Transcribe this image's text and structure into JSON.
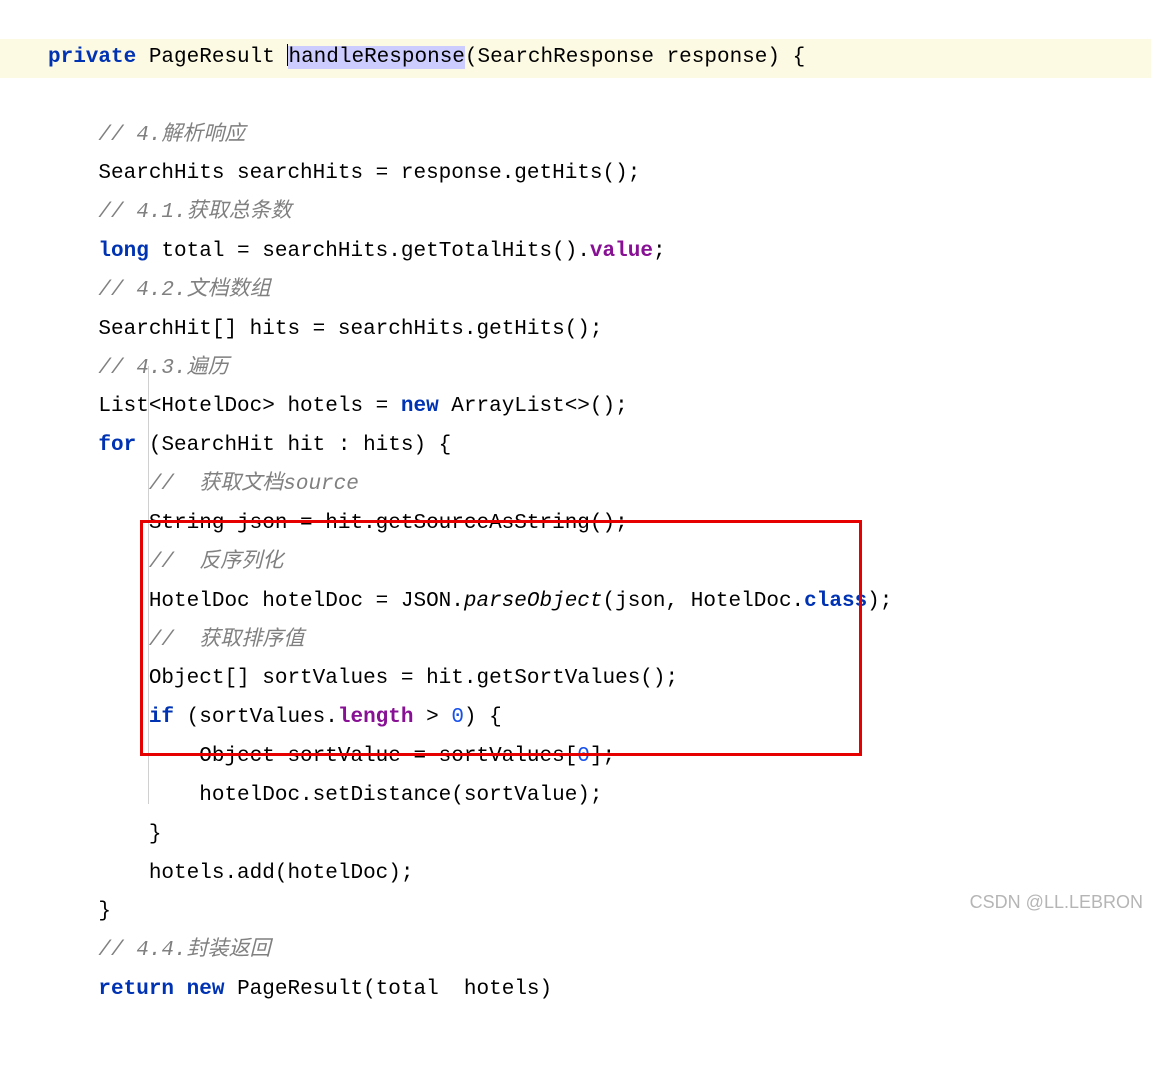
{
  "signature": {
    "modifier": "private",
    "returnType": "PageResult",
    "methodName": "handleResponse",
    "paramType": "SearchResponse",
    "paramName": "response",
    "open": "{"
  },
  "lines": {
    "c4": "// 4.解析响应",
    "l1a": "SearchHits searchHits = response.getHits();",
    "c41": "// 4.1.获取总条数",
    "l2_kw": "long",
    "l2_mid": " total = searchHits.getTotalHits().",
    "l2_field": "value",
    "l2_end": ";",
    "c42": "// 4.2.文档数组",
    "l3": "SearchHit[] hits = searchHits.getHits();",
    "c43": "// 4.3.遍历",
    "l4a": "List<HotelDoc> hotels = ",
    "l4_new": "new",
    "l4b": " ArrayList<>();",
    "l5_for": "for",
    "l5_rest": " (SearchHit hit : hits) {",
    "c_src": "//  获取文档source",
    "l6": "String json = hit.getSourceAsString();",
    "c_des": "//  反序列化",
    "l7a": "HotelDoc hotelDoc = JSON.",
    "l7_m": "parseObject",
    "l7b": "(json, HotelDoc.",
    "l7_cls": "class",
    "l7c": ");",
    "c_sort": "//  获取排序值",
    "l8": "Object[] sortValues = hit.getSortValues();",
    "l9_if": "if",
    "l9a": " (sortValues.",
    "l9_len": "length",
    "l9b": " > ",
    "l9_zero": "0",
    "l9c": ") {",
    "l10a": "Object sortValue = sortValues[",
    "l10_zero": "0",
    "l10b": "];",
    "l11": "hotelDoc.setDistance(sortValue);",
    "l12": "}",
    "l13": "hotels.add(hotelDoc);",
    "l14": "}",
    "c44": "// 4.4.封装返回",
    "l15_ret": "return",
    "l15_sp": " ",
    "l15_new": "new",
    "l15_rest": " PageResult(total  hotels)"
  },
  "watermark": "CSDN @LL.LEBRON"
}
